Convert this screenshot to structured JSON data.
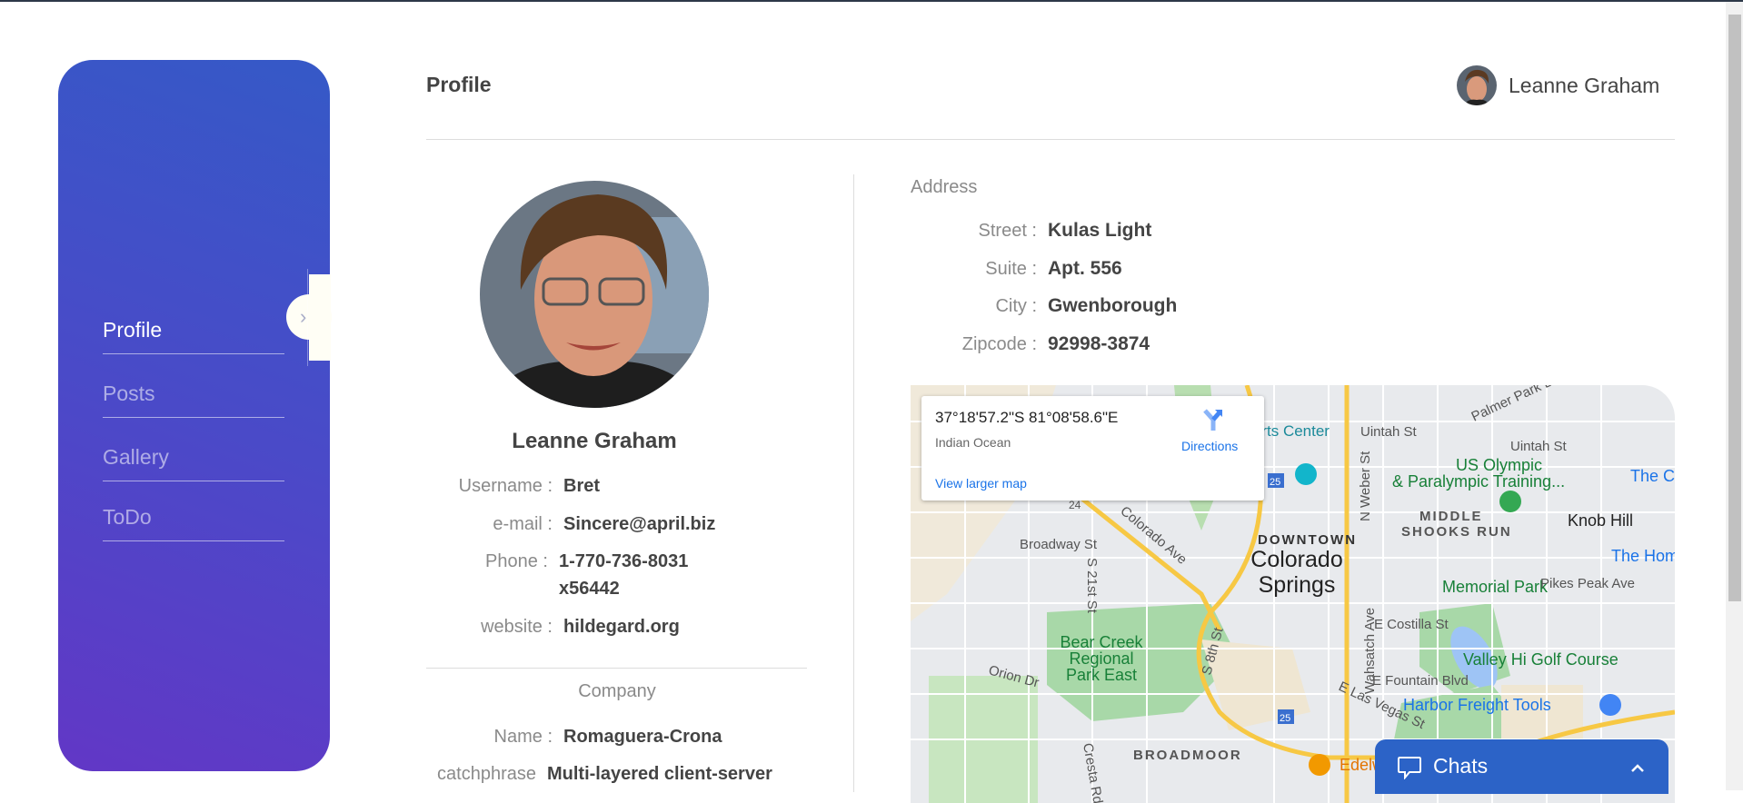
{
  "sidebar": {
    "items": [
      {
        "label": "Profile",
        "active": true
      },
      {
        "label": "Posts"
      },
      {
        "label": "Gallery"
      },
      {
        "label": "ToDo"
      }
    ]
  },
  "header": {
    "title": "Profile",
    "user_name": "Leanne Graham"
  },
  "profile": {
    "name": "Leanne Graham",
    "fields": [
      {
        "label": "Username :",
        "value": "Bret"
      },
      {
        "label": "e-mail :",
        "value": "Sincere@april.biz"
      },
      {
        "label": "Phone :",
        "value": "1-770-736-8031",
        "value2": "x56442"
      },
      {
        "label": "website :",
        "value": "hildegard.org"
      }
    ],
    "company_heading": "Company",
    "company": [
      {
        "label": "Name :",
        "value": "Romaguera-Crona"
      },
      {
        "label": "catchphrase",
        "value": "Multi-layered client-server"
      }
    ]
  },
  "address": {
    "heading": "Address",
    "fields": [
      {
        "label": "Street :",
        "value": "Kulas Light"
      },
      {
        "label": "Suite :",
        "value": "Apt. 556"
      },
      {
        "label": "City :",
        "value": "Gwenborough"
      },
      {
        "label": "Zipcode :",
        "value": "92998-3874"
      }
    ]
  },
  "map": {
    "coords": "37°18'57.2\"S 81°08'58.6\"E",
    "place": "Indian Ocean",
    "directions": "Directions",
    "larger": "View larger map",
    "labels": [
      "Arts Center",
      "Uintah St",
      "Palmer Park Blvd",
      "Uintah St",
      "US Olympic",
      "& Paralympic Training...",
      "The Ci",
      "MIDDLE",
      "SHOOKS RUN",
      "Knob Hill",
      "DOWNTOWN",
      "Colorado",
      "Springs",
      "The Hom",
      "Memorial Park",
      "Pikes Peak Ave",
      "E Costilla St",
      "Broadway St",
      "Colorado Ave",
      "Bear Creek",
      "Regional",
      "Park East",
      "Valley Hi Golf Course",
      "E Fountain Blvd",
      "Harbor Freight Tools",
      "E Las Vegas St",
      "BROADMOOR",
      "Edelw",
      "Orion Dr",
      "S 21st St",
      "N Weber St",
      "Wahsatch Ave",
      "S 8th St",
      "Cresta Rd",
      "24",
      "25",
      "25"
    ]
  },
  "chat": {
    "label": "Chats"
  },
  "colors": {
    "accent": "#2c63c7",
    "sidebar_top": "#3559c7",
    "sidebar_bottom": "#6237c6"
  }
}
